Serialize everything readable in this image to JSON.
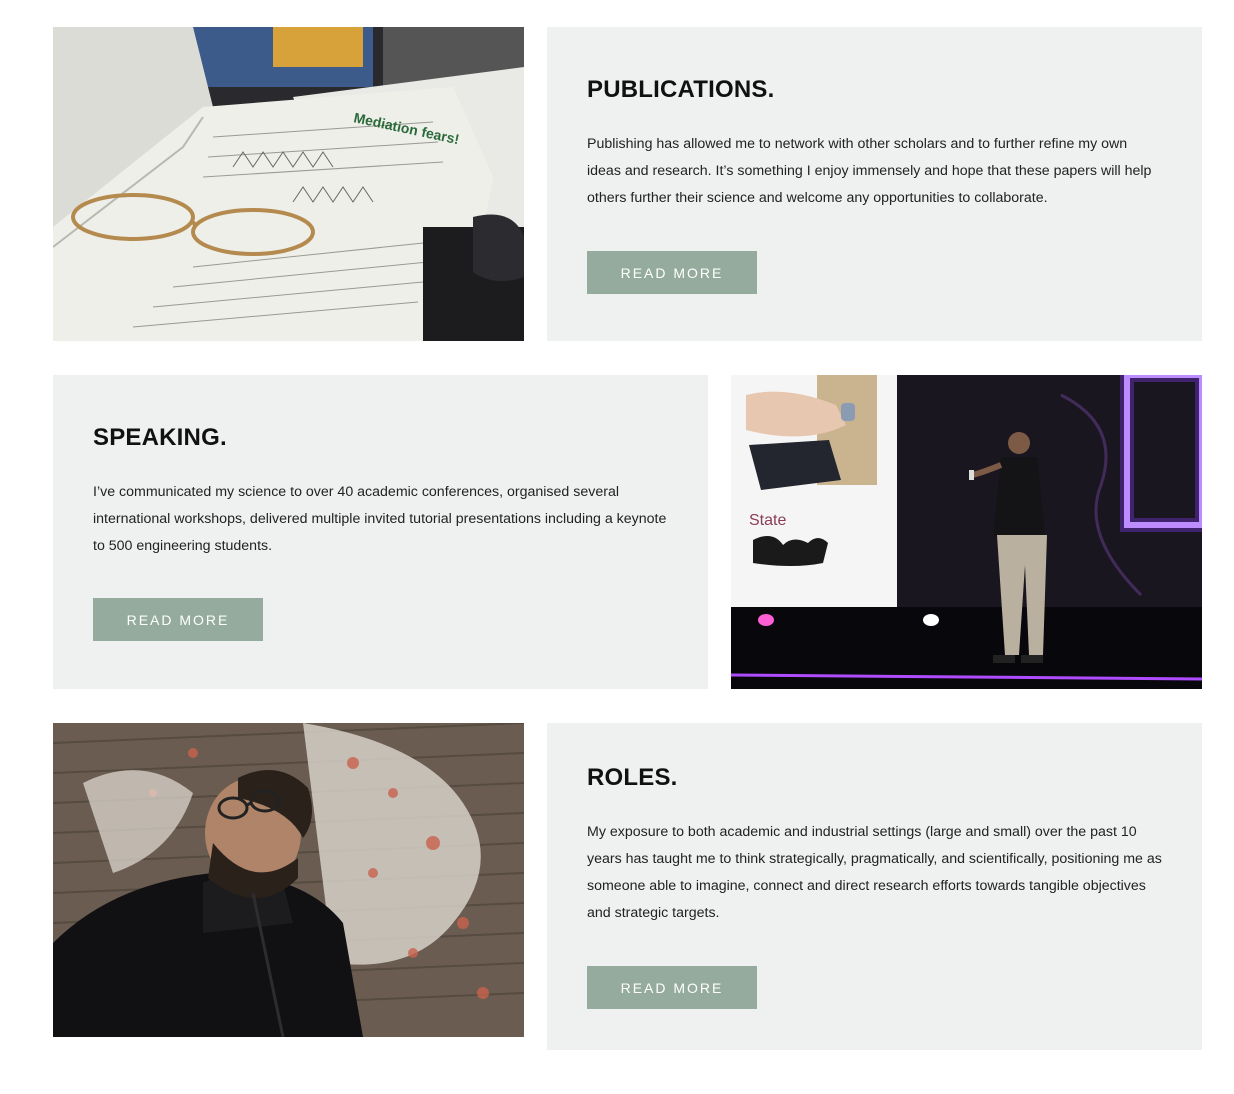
{
  "sections": [
    {
      "title": "PUBLICATIONS.",
      "body": "Publishing has allowed me to network with other scholars and to further refine my own ideas and research. It’s something I enjoy immensely and hope that these papers will help others further their science and welcome any opportunities to collaborate.",
      "button_label": "READ MORE",
      "image": {
        "text": "Mediation fears!"
      }
    },
    {
      "title": "SPEAKING.",
      "body": "I’ve communicated my science to over 40 academic conferences, organised several international workshops, delivered multiple invited tutorial presentations including a keynote to 500 engineering students.",
      "button_label": "READ MORE",
      "image": {
        "slide_text": "State"
      }
    },
    {
      "title": "ROLES.",
      "body": "My exposure to both academic and industrial settings (large and small) over the past 10 years has taught me to think strategically, pragmatically, and scientifically, positioning me as someone able to imagine, connect and direct research efforts towards tangible objectives and strategic targets.",
      "button_label": "READ MORE",
      "image": {}
    }
  ],
  "colors": {
    "card_bg": "#eff1f0",
    "button_bg": "#94ab9d",
    "button_text": "#ffffff",
    "heading": "#111111"
  }
}
